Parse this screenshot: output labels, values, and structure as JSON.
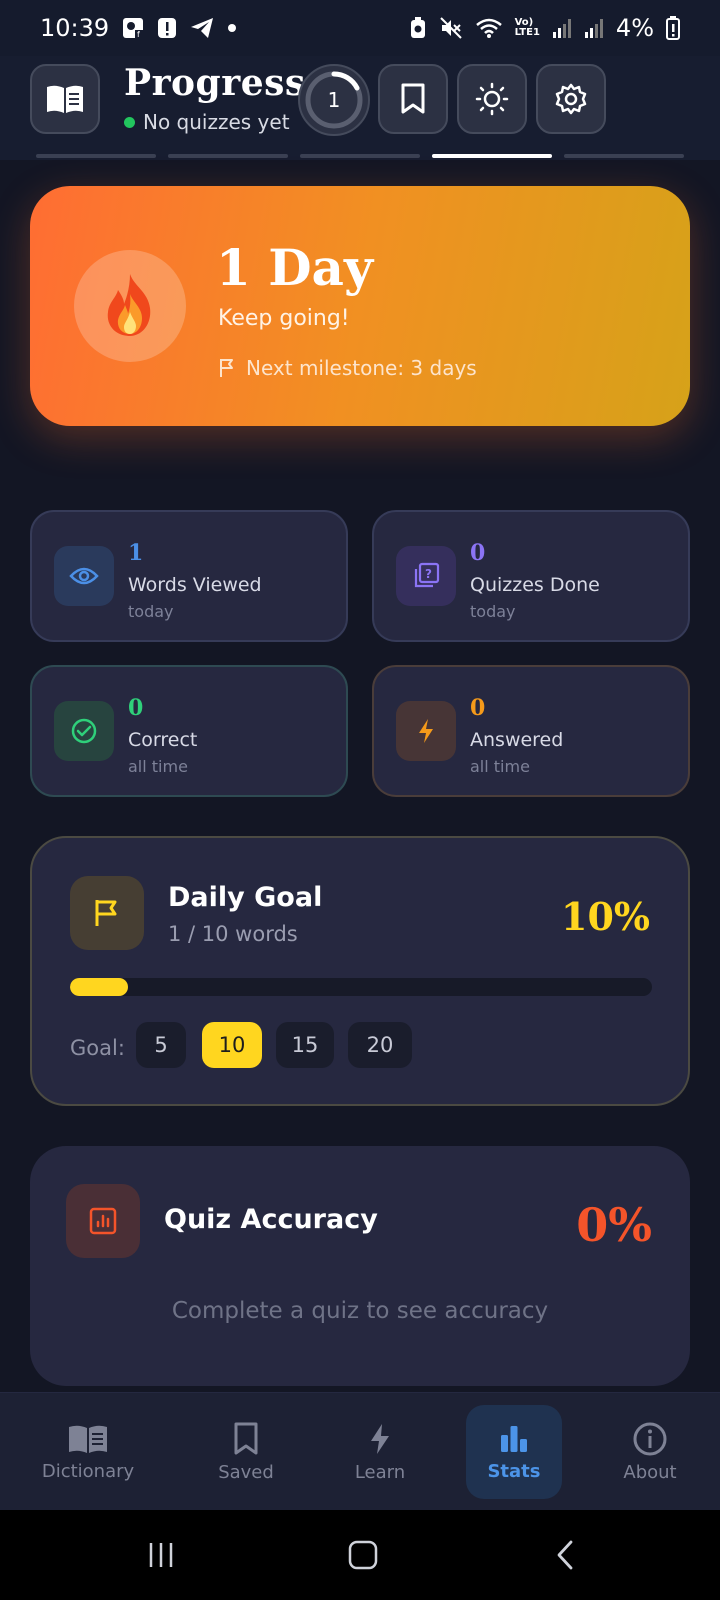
{
  "status_bar": {
    "time": "10:39",
    "battery": "4%",
    "network": "Vo)\nLTE1"
  },
  "header": {
    "title": "Progress",
    "subtitle": "No quizzes yet",
    "streak_ring_value": "1"
  },
  "streak": {
    "title": "1 Day",
    "subtitle": "Keep going!",
    "milestone": "Next milestone: 3 days"
  },
  "stats": [
    {
      "value": "1",
      "label": "Words Viewed",
      "period": "today",
      "color": "#4b8fe6"
    },
    {
      "value": "0",
      "label": "Quizzes Done",
      "period": "today",
      "color": "#8b74f5"
    },
    {
      "value": "0",
      "label": "Correct",
      "period": "all time",
      "color": "#2fd07a"
    },
    {
      "value": "0",
      "label": "Answered",
      "period": "all time",
      "color": "#f59a1a"
    }
  ],
  "daily_goal": {
    "title": "Daily Goal",
    "progress_text": "1 / 10 words",
    "percent": "10%",
    "progress_fraction": 0.1,
    "goal_label": "Goal:",
    "options": [
      "5",
      "10",
      "15",
      "20"
    ],
    "selected": "10"
  },
  "quiz_accuracy": {
    "title": "Quiz Accuracy",
    "percent": "0%",
    "empty_message": "Complete a quiz to see accuracy"
  },
  "bottom_nav": [
    {
      "label": "Dictionary",
      "icon": "book-icon"
    },
    {
      "label": "Saved",
      "icon": "bookmark-icon"
    },
    {
      "label": "Learn",
      "icon": "bolt-icon"
    },
    {
      "label": "Stats",
      "icon": "bar-chart-icon",
      "active": true
    },
    {
      "label": "About",
      "icon": "info-icon"
    }
  ],
  "colors": {
    "accent_yellow": "#ffd61f",
    "accent_red": "#f4542a",
    "accent_blue": "#4c94e8",
    "background": "#131624"
  }
}
